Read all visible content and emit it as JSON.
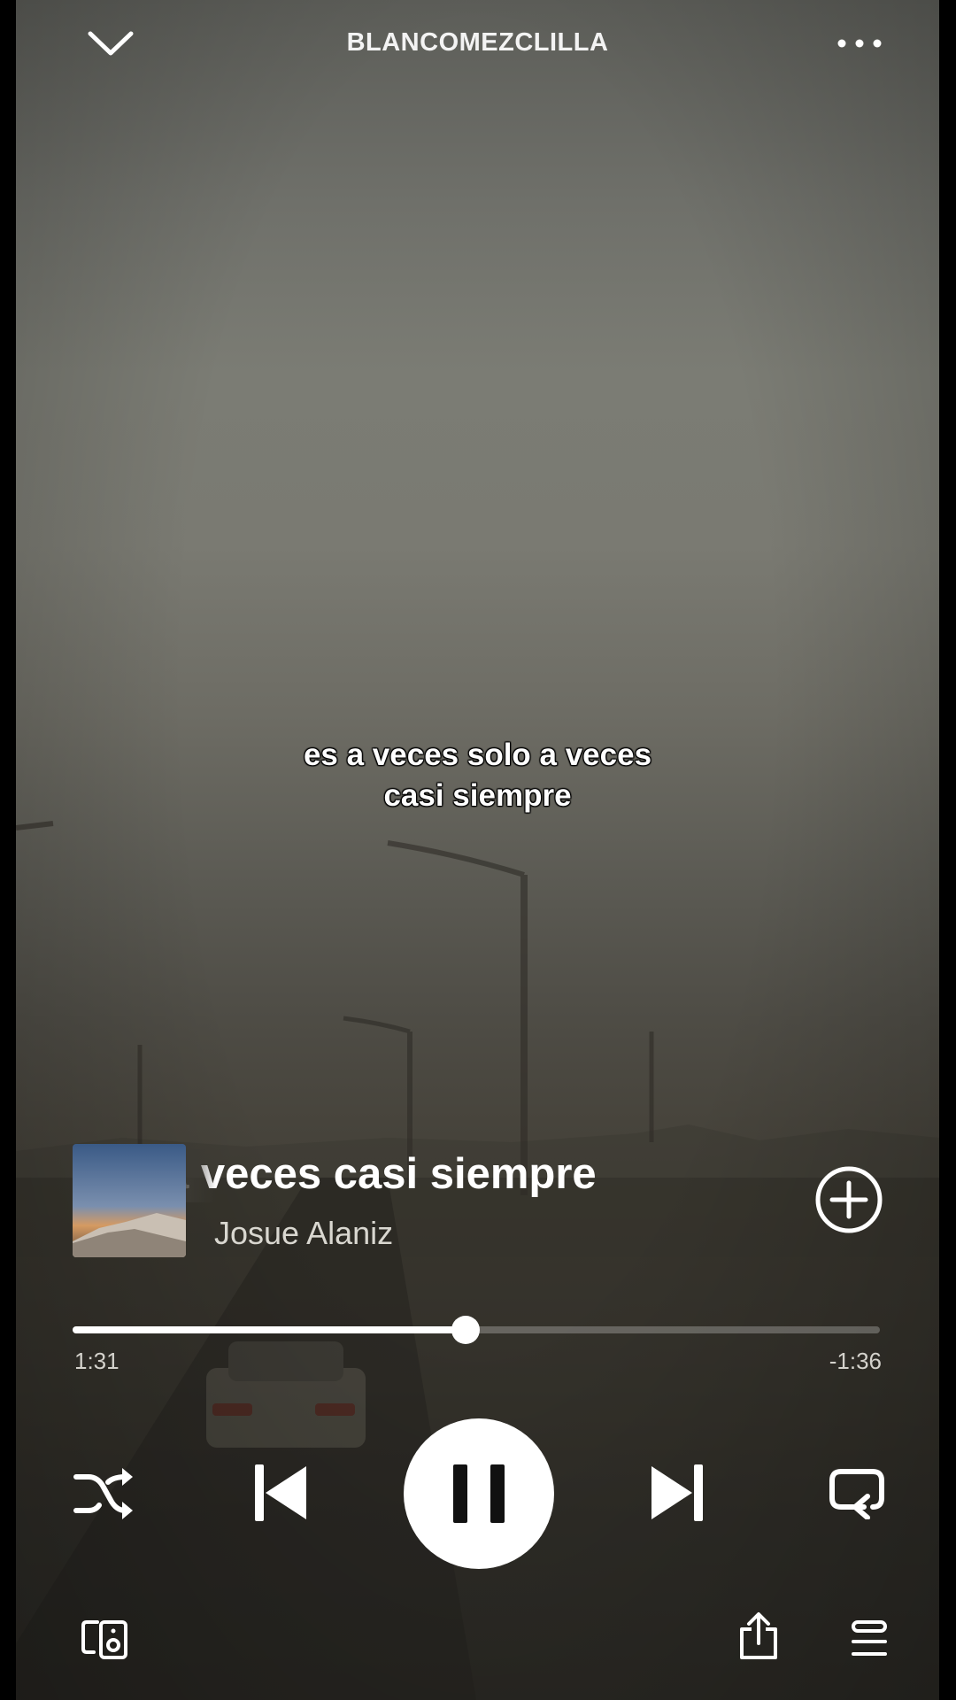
{
  "header": {
    "playlist_title": "BLANCOMEZCLILLA",
    "collapse_icon": "chevron-down-icon",
    "more_icon": "more-dots-icon"
  },
  "lyrics": {
    "line1": "es a veces solo a veces",
    "line2": "casi siempre"
  },
  "track": {
    "title_visible": "a veces casi siempre",
    "artist": "Josue Alaniz",
    "add_icon": "add-circle-icon"
  },
  "progress": {
    "elapsed": "1:31",
    "remaining": "-1:36",
    "fraction": 0.487
  },
  "controls": {
    "shuffle_icon": "shuffle-icon",
    "previous_icon": "skip-previous-icon",
    "play_pause_icon": "pause-icon",
    "next_icon": "skip-next-icon",
    "repeat_icon": "repeat-icon"
  },
  "bottom_bar": {
    "devices_icon": "connect-devices-icon",
    "share_icon": "share-icon",
    "queue_icon": "queue-icon"
  },
  "colors": {
    "accent": "#ffffff",
    "text_secondary": "#d4d2cc"
  }
}
